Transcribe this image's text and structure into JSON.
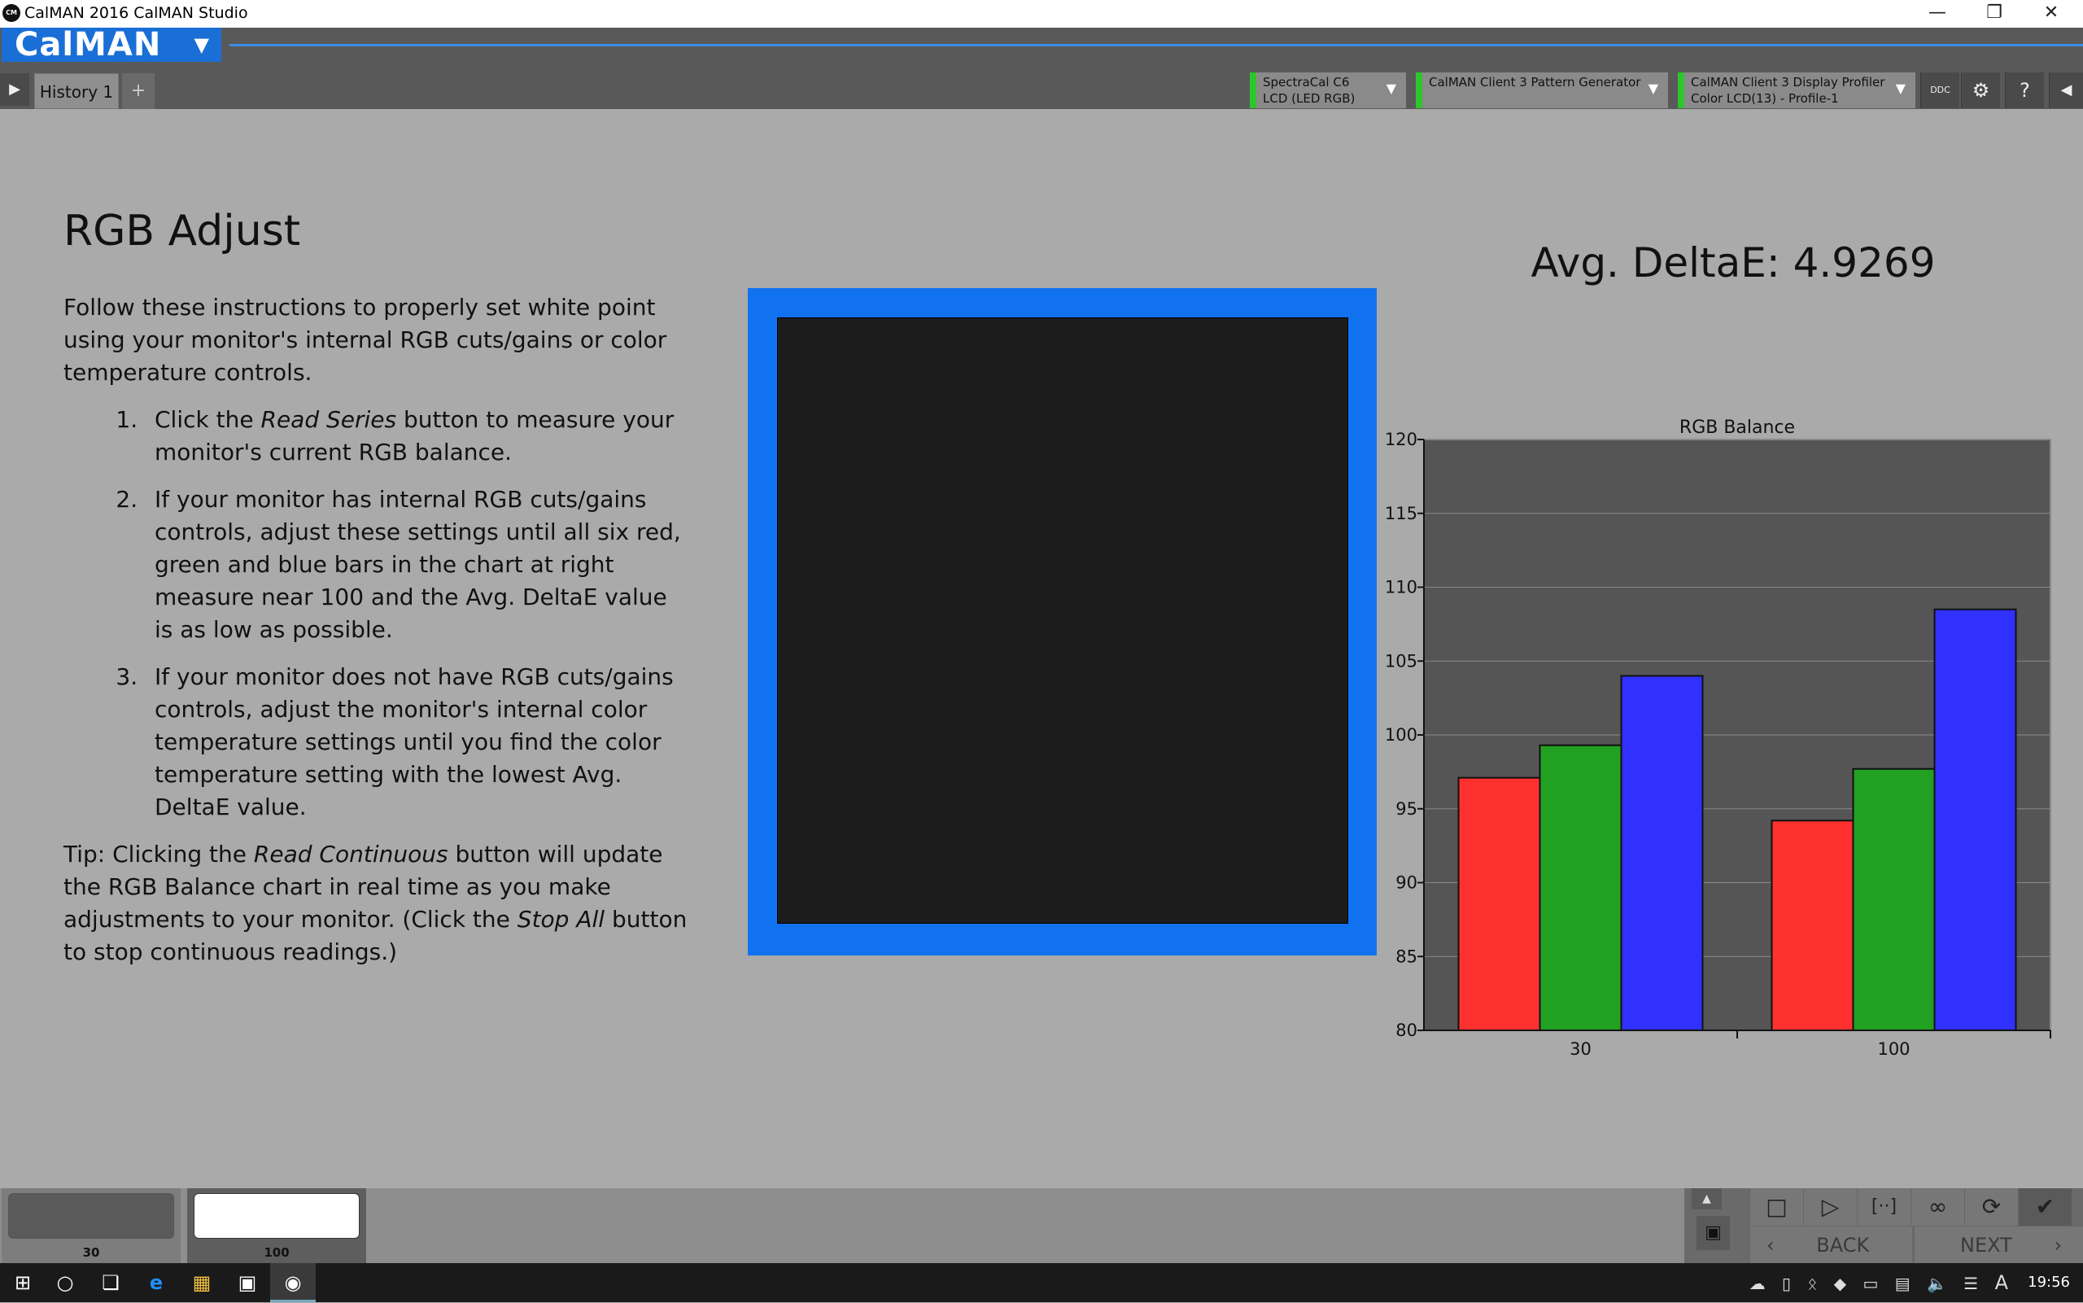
{
  "window": {
    "title": "CalMAN 2016 CalMAN Studio",
    "app_icon": "CM"
  },
  "header": {
    "logo": "CalMAN",
    "tabs": [
      {
        "label": "History 1"
      }
    ],
    "add_tab": "+",
    "devices": [
      {
        "line1": "SpectraCal C6",
        "line2": "LCD (LED RGB)"
      },
      {
        "line1": "CalMAN Client 3 Pattern Generator",
        "line2": ""
      },
      {
        "line1": "CalMAN Client 3 Display Profiler",
        "line2": "Color LCD(13) - Profile-1"
      }
    ],
    "ddc_label": "DDC"
  },
  "main": {
    "title": "RGB Adjust",
    "intro": "Follow these instructions to properly set white point using your monitor's internal RGB cuts/gains or color temperature controls.",
    "steps": [
      {
        "pre": "Click the ",
        "em": "Read Series",
        "post": " button to measure your monitor's current RGB balance."
      },
      {
        "pre": "If your monitor has internal RGB cuts/gains controls, adjust these settings until all six red, green and blue bars in the chart at right measure near 100 and the Avg. DeltaE value is as low as possible.",
        "em": "",
        "post": ""
      },
      {
        "pre": "If your monitor does not have RGB cuts/gains controls, adjust the monitor's internal color temperature settings until you find the color temperature setting with the lowest Avg. DeltaE value.",
        "em": "",
        "post": ""
      }
    ],
    "tip": {
      "pre": "Tip: Clicking the ",
      "em1": "Read Continuous",
      "mid": " button will update the RGB Balance chart in real time as you make adjustments to your monitor. (Click the ",
      "em2": "Stop All",
      "post": " button to stop continuous readings.)"
    },
    "deltae_label": "Avg. DeltaE: ",
    "deltae_value": "4.9269"
  },
  "chart_data": {
    "type": "bar",
    "title": "RGB Balance",
    "categories": [
      "30",
      "100"
    ],
    "series": [
      {
        "color": "#ff3030",
        "values": [
          97.1,
          94.2
        ]
      },
      {
        "color": "#22a022",
        "values": [
          99.3,
          97.7
        ]
      },
      {
        "color": "#3030ff",
        "values": [
          104.0,
          108.5
        ]
      }
    ],
    "ylim": [
      80,
      120
    ],
    "yticks": [
      80,
      85,
      90,
      95,
      100,
      105,
      110,
      115,
      120
    ],
    "grid": true,
    "background": "#555555"
  },
  "bottom": {
    "thumbnails": [
      {
        "label": "30",
        "color": "#5a5a5a"
      },
      {
        "label": "100",
        "color": "#ffffff"
      }
    ],
    "back_label": "BACK",
    "next_label": "NEXT"
  },
  "taskbar": {
    "time": "19:56",
    "ime": "A"
  }
}
